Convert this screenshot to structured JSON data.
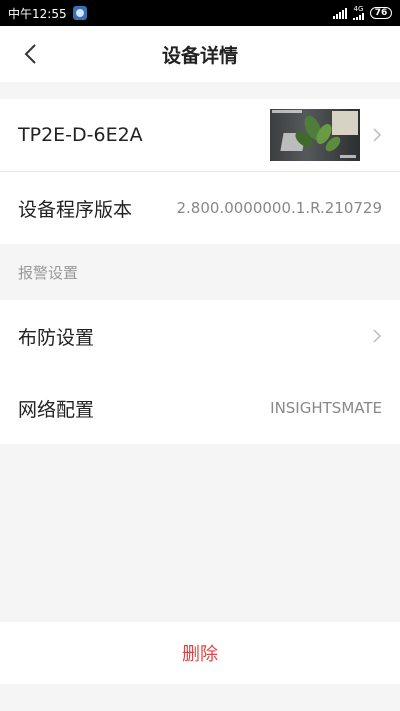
{
  "status_bar": {
    "time": "中午12:55",
    "network": "4G",
    "battery": "76"
  },
  "header": {
    "title": "设备详情"
  },
  "device": {
    "name": "TP2E-D-6E2A"
  },
  "firmware": {
    "label": "设备程序版本",
    "value": "2.800.0000000.1.R.210729"
  },
  "alarm_section": {
    "title": "报警设置"
  },
  "arming": {
    "label": "布防设置"
  },
  "network_config": {
    "label": "网络配置",
    "value": "INSIGHTSMATE"
  },
  "actions": {
    "delete_label": "删除"
  },
  "colors": {
    "accent_red": "#e04545",
    "background": "#f5f5f5"
  }
}
